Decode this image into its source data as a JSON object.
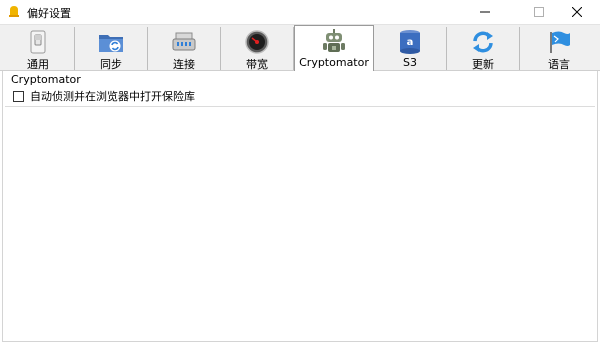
{
  "window": {
    "title": "偏好设置",
    "app_icon": "app-bell-icon",
    "controls": [
      "minimize-icon",
      "maximize-icon",
      "close-icon"
    ]
  },
  "tabs": [
    {
      "label": "通用",
      "icon": "switch-icon"
    },
    {
      "label": "同步",
      "icon": "sync-folder-icon"
    },
    {
      "label": "连接",
      "icon": "network-connector-icon"
    },
    {
      "label": "带宽",
      "icon": "speed-gauge-icon"
    },
    {
      "label": "Cryptomator",
      "icon": "cryptomator-robot-icon",
      "selected": true
    },
    {
      "label": "S3",
      "icon": "amazon-s3-icon"
    },
    {
      "label": "更新",
      "icon": "update-arrows-icon"
    },
    {
      "label": "语言",
      "icon": "flag-icon"
    }
  ],
  "panel": {
    "group_title": "Cryptomator",
    "checkbox_label": "自动侦测并在浏览器中打开保险库",
    "checkbox_checked": false
  },
  "colors": {
    "toolbar_bg": "#f0f0f0",
    "selected_tab_bg": "#ffffff",
    "accent_blue": "#2f7fd8"
  }
}
